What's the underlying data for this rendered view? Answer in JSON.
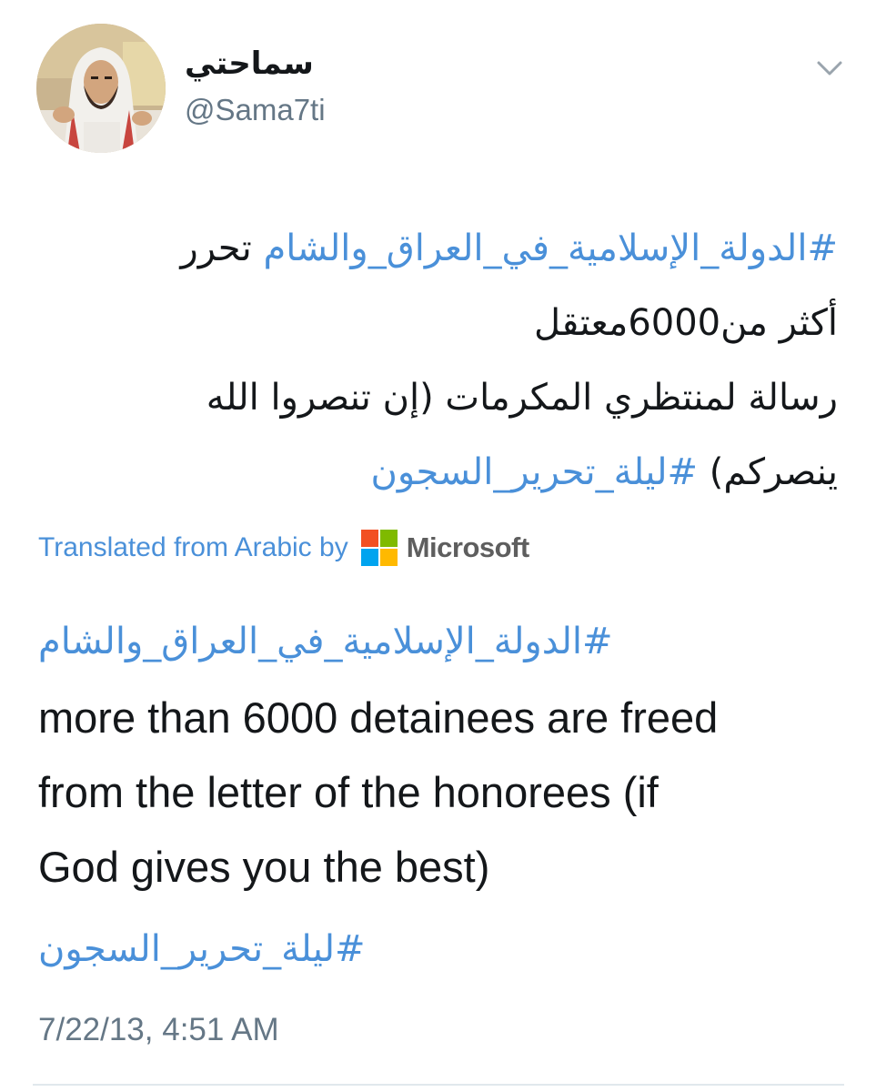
{
  "user": {
    "display_name": "سماحتي",
    "handle": "@Sama7ti",
    "avatar_icon": "profile-photo"
  },
  "menu": {
    "icon": "chevron-down-icon"
  },
  "tweet": {
    "line1_hashtag": "#الدولة_الإسلامية_في_العراق_والشام",
    "line1_text": " تحرر",
    "line2": "أكثر من6000معتقل",
    "line3": "رسالة لمنتظري المكرمات (إن تنصروا الله",
    "line4_text": "ينصركم) ",
    "line4_hashtag": "#ليلة_تحرير_السجون"
  },
  "translation_banner": {
    "label": "Translated from Arabic by",
    "provider": "Microsoft",
    "logo_colors": [
      "#f25022",
      "#7fba00",
      "#00a4ef",
      "#ffb900"
    ]
  },
  "translation": {
    "hashtag_top": "#الدولة_الإسلامية_في_العراق_والشام",
    "lines": [
      "more than 6000 detainees are freed",
      "from the letter of the honorees (if",
      "God gives you the best)"
    ],
    "hashtag_bottom": "#ليلة_تحرير_السجون"
  },
  "timestamp": "7/22/13, 4:51 AM",
  "colors": {
    "link": "#4a90d9",
    "text": "#14171a",
    "secondary": "#657786",
    "divider": "#e1e8ed"
  }
}
